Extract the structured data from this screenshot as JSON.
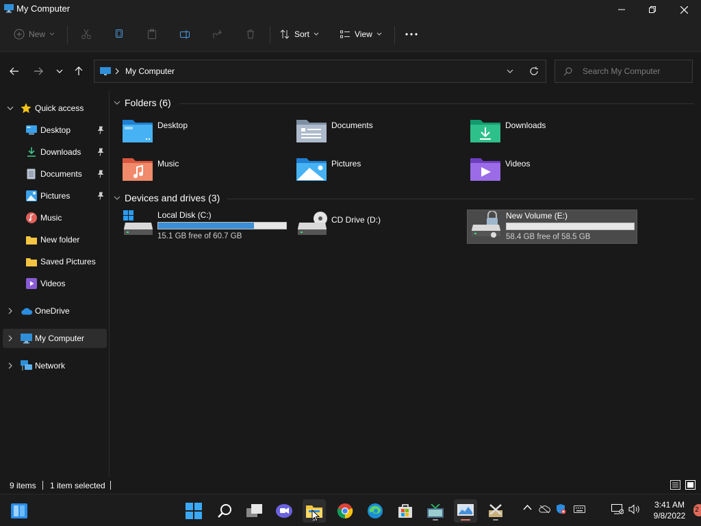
{
  "window": {
    "title": "My Computer"
  },
  "commandbar": {
    "new_label": "New",
    "sort_label": "Sort",
    "view_label": "View"
  },
  "address": {
    "location": "My Computer",
    "search_placeholder": "Search My Computer"
  },
  "sidebar": {
    "quick_access": "Quick access",
    "quick_items": [
      {
        "label": "Desktop",
        "pinned": true
      },
      {
        "label": "Downloads",
        "pinned": true
      },
      {
        "label": "Documents",
        "pinned": true
      },
      {
        "label": "Pictures",
        "pinned": true
      },
      {
        "label": "Music",
        "pinned": false
      },
      {
        "label": "New folder",
        "pinned": false
      },
      {
        "label": "Saved Pictures",
        "pinned": false
      },
      {
        "label": "Videos",
        "pinned": false
      }
    ],
    "onedrive": "OneDrive",
    "my_computer": "My Computer",
    "network": "Network"
  },
  "content": {
    "folders_header": "Folders (6)",
    "folders": [
      "Desktop",
      "Documents",
      "Downloads",
      "Music",
      "Pictures",
      "Videos"
    ],
    "devices_header": "Devices and drives (3)",
    "drives": [
      {
        "name": "Local Disk (C:)",
        "free_text": "15.1 GB free of 60.7 GB",
        "used_fraction": 0.75
      },
      {
        "name": "CD Drive (D:)"
      },
      {
        "name": "New Volume (E:)",
        "free_text": "58.4 GB free of 58.5 GB",
        "used_fraction": 0.0,
        "selected": true
      }
    ]
  },
  "status": {
    "items_count": "9 items",
    "selection": "1 item selected"
  },
  "taskbar": {
    "time": "3:41 AM",
    "date": "9/8/2022",
    "notification_count": "2"
  },
  "colors": {
    "accent": "#3c8fd6",
    "background": "#191919",
    "chrome": "#202020",
    "selected": "#4a4a4a"
  }
}
